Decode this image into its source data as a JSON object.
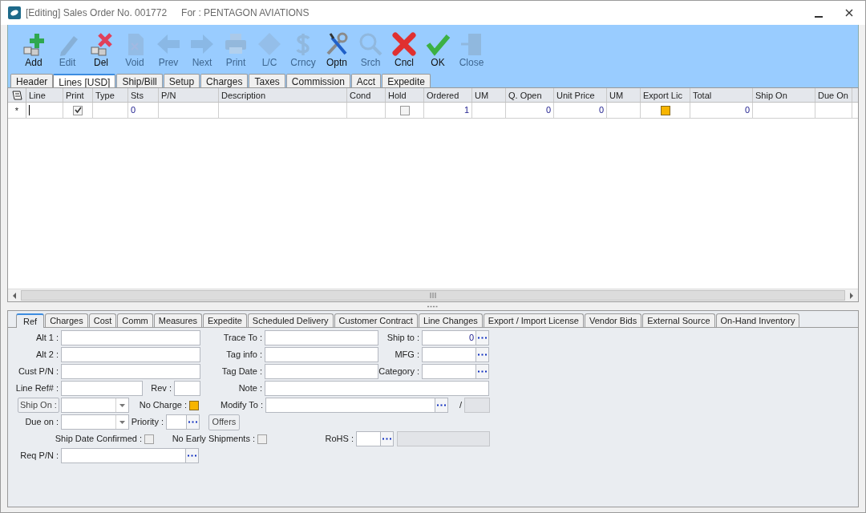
{
  "window": {
    "title": "[Editing] Sales Order No. 001772",
    "subtitle": "For : PENTAGON AVIATIONS"
  },
  "toolbar": [
    {
      "kind": "add",
      "label": "Add",
      "disabled": false
    },
    {
      "kind": "edit",
      "label": "Edit",
      "disabled": true
    },
    {
      "kind": "delete",
      "label": "Del",
      "disabled": false
    },
    {
      "kind": "void",
      "label": "Void",
      "disabled": true
    },
    {
      "kind": "prev",
      "label": "Prev",
      "disabled": true
    },
    {
      "kind": "next",
      "label": "Next",
      "disabled": true
    },
    {
      "kind": "print",
      "label": "Print",
      "disabled": true
    },
    {
      "kind": "lc",
      "label": "L/C",
      "disabled": true
    },
    {
      "kind": "currency",
      "label": "Crncy",
      "disabled": true
    },
    {
      "kind": "options",
      "label": "Optn",
      "disabled": false
    },
    {
      "kind": "search",
      "label": "Srch",
      "disabled": true
    },
    {
      "kind": "cancel",
      "label": "Cncl",
      "disabled": false
    },
    {
      "kind": "ok",
      "label": "OK",
      "disabled": false
    },
    {
      "kind": "close",
      "label": "Close",
      "disabled": true
    }
  ],
  "tabs": [
    {
      "label": "Header",
      "selected": false
    },
    {
      "label": "Lines [USD]",
      "selected": true
    },
    {
      "label": "Ship/Bill",
      "selected": false
    },
    {
      "label": "Setup",
      "selected": false
    },
    {
      "label": "Charges",
      "selected": false
    },
    {
      "label": "Taxes",
      "selected": false
    },
    {
      "label": "Commission",
      "selected": false
    },
    {
      "label": "Acct",
      "selected": false
    },
    {
      "label": "Expedite",
      "selected": false
    }
  ],
  "grid": {
    "columns": [
      "Line",
      "Print",
      "Type",
      "Sts",
      "P/N",
      "Description",
      "Cond",
      "Hold",
      "Ordered",
      "UM",
      "Q. Open",
      "Unit Price",
      "UM",
      "Export Lic",
      "Total",
      "Ship On",
      "Due On"
    ],
    "rows": [
      {
        "marker": "*",
        "cells": [
          {
            "kind": "text",
            "editing": true
          },
          {
            "kind": "check",
            "checked": true
          },
          {
            "kind": "text"
          },
          {
            "kind": "text",
            "value": "0"
          },
          {
            "kind": "text"
          },
          {
            "kind": "text"
          },
          {
            "kind": "text"
          },
          {
            "kind": "check",
            "checked": false
          },
          {
            "kind": "number",
            "value": "1"
          },
          {
            "kind": "text"
          },
          {
            "kind": "number",
            "value": "0"
          },
          {
            "kind": "number",
            "value": "0"
          },
          {
            "kind": "text"
          },
          {
            "kind": "flag",
            "checked": true
          },
          {
            "kind": "number",
            "value": "0"
          },
          {
            "kind": "text"
          },
          {
            "kind": "text"
          }
        ]
      }
    ]
  },
  "detail_tabs": [
    {
      "label": "Ref",
      "selected": true
    },
    {
      "label": "Charges",
      "selected": false
    },
    {
      "label": "Cost",
      "selected": false
    },
    {
      "label": "Comm",
      "selected": false
    },
    {
      "label": "Measures",
      "selected": false
    },
    {
      "label": "Expedite",
      "selected": false
    },
    {
      "label": "Scheduled Delivery",
      "selected": false
    },
    {
      "label": "Customer Contract",
      "selected": false
    },
    {
      "label": "Line Changes",
      "selected": false
    },
    {
      "label": "Export / Import License",
      "selected": false
    },
    {
      "label": "Vendor Bids",
      "selected": false
    },
    {
      "label": "External Source",
      "selected": false
    },
    {
      "label": "On-Hand Inventory",
      "selected": false
    }
  ],
  "form_rows": [
    [
      {
        "kind": "text",
        "label": "Alt 1 :"
      },
      {
        "kind": "text",
        "label": "Trace To :"
      },
      {
        "kind": "lookup",
        "label": "Ship to :",
        "value": "0"
      }
    ],
    [
      {
        "kind": "text",
        "label": "Alt 2 :"
      },
      {
        "kind": "text",
        "label": "Tag info :"
      },
      {
        "kind": "lookup",
        "label": "MFG :"
      }
    ],
    [
      {
        "kind": "text",
        "label": "Cust P/N :"
      },
      {
        "kind": "text",
        "label": "Tag Date :"
      },
      {
        "kind": "lookup",
        "label": "Category :"
      }
    ],
    [
      {
        "kind": "text",
        "label": "Line Ref# :"
      },
      {
        "kind": "text",
        "label": "Rev :"
      },
      {
        "kind": "text",
        "label": "Note :"
      }
    ],
    [
      {
        "kind": "combo_button",
        "label": "Ship On :"
      },
      {
        "kind": "checkbox",
        "label": "No Charge :",
        "checked": true
      },
      {
        "kind": "lookup",
        "label": "Modify To :"
      },
      {
        "kind": "readonly",
        "label": "/"
      }
    ],
    [
      {
        "kind": "combo",
        "label": "Due on :"
      },
      {
        "kind": "lookup",
        "label": "Priority :"
      },
      {
        "kind": "button",
        "label": "Offers"
      }
    ],
    [
      {
        "kind": "checkbox",
        "label": "Ship Date Confirmed :",
        "checked": false
      },
      {
        "kind": "checkbox",
        "label": "No Early Shipments :",
        "checked": false
      },
      {
        "kind": "lookup",
        "label": "RoHS :"
      },
      {
        "kind": "readonly"
      }
    ],
    [
      {
        "kind": "lookup",
        "label": "Req P/N :"
      }
    ]
  ]
}
